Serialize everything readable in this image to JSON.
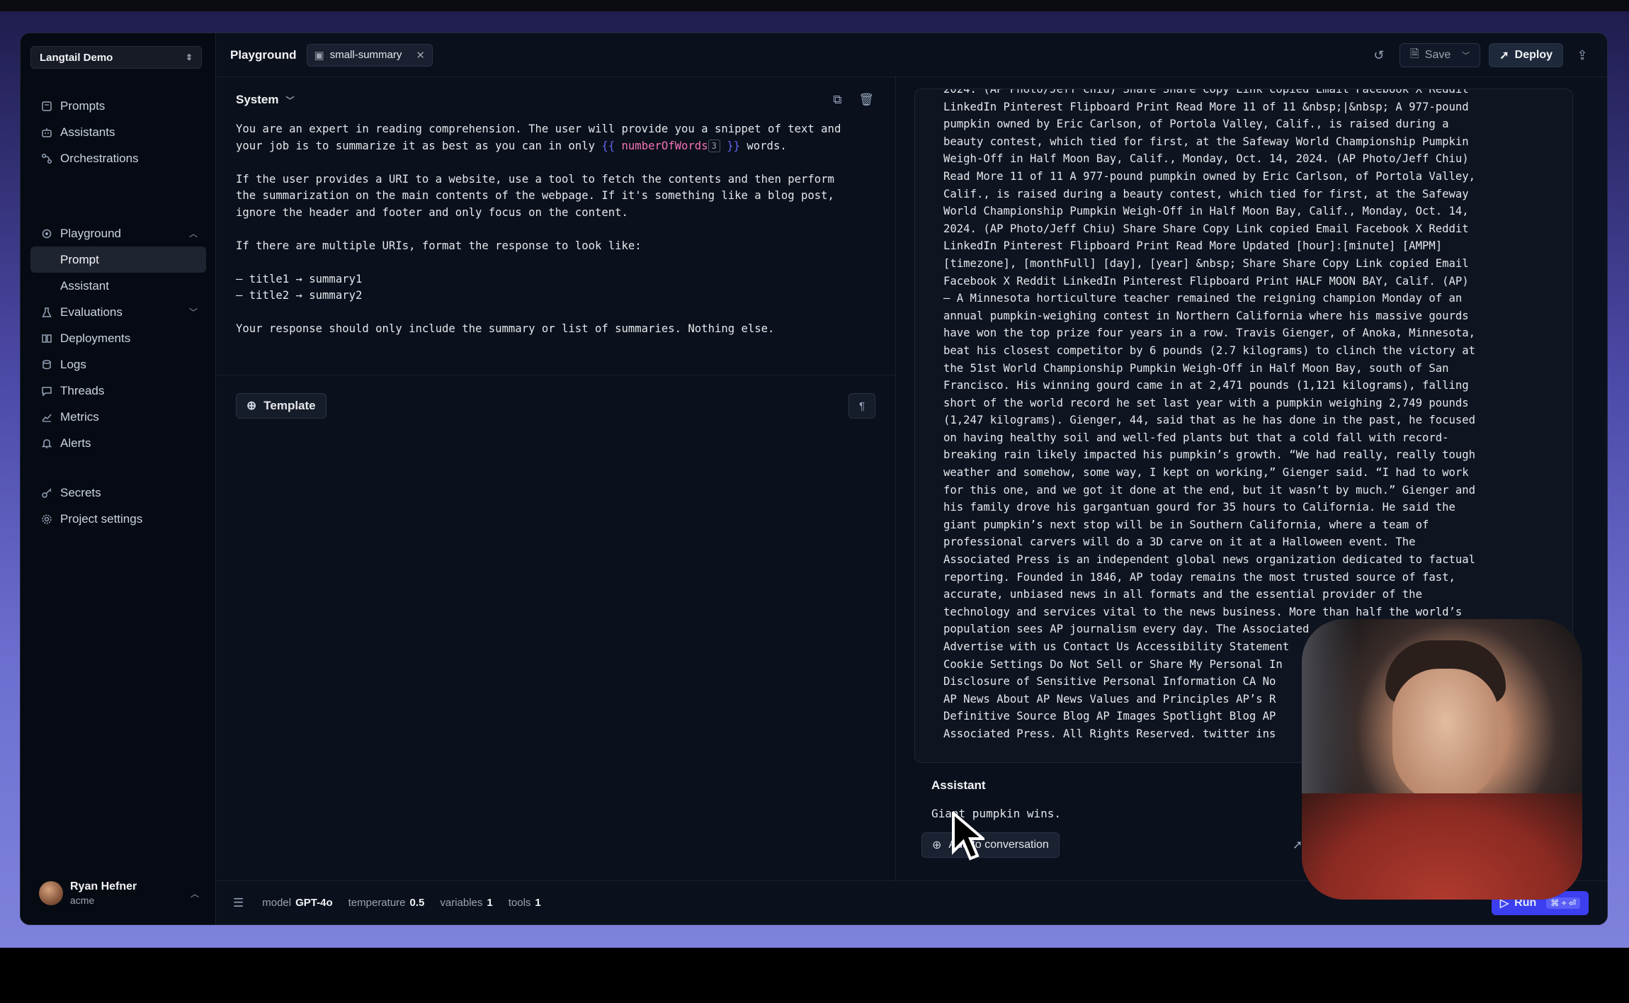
{
  "project": {
    "name": "Langtail Demo"
  },
  "sidebar": {
    "items": [
      {
        "label": "Prompts",
        "icon": "file-icon"
      },
      {
        "label": "Assistants",
        "icon": "robot-icon"
      },
      {
        "label": "Orchestrations",
        "icon": "flow-icon"
      },
      {
        "label": "Playground",
        "icon": "playground-icon"
      },
      {
        "label": "Prompt"
      },
      {
        "label": "Assistant"
      },
      {
        "label": "Evaluations",
        "icon": "flask-icon"
      },
      {
        "label": "Deployments",
        "icon": "deploy-icon"
      },
      {
        "label": "Logs",
        "icon": "database-icon"
      },
      {
        "label": "Threads",
        "icon": "chat-icon"
      },
      {
        "label": "Metrics",
        "icon": "chart-icon"
      },
      {
        "label": "Alerts",
        "icon": "bell-icon"
      },
      {
        "label": "Secrets",
        "icon": "key-icon"
      },
      {
        "label": "Project settings",
        "icon": "gear-icon"
      }
    ],
    "user": {
      "name": "Ryan Hefner",
      "org": "acme"
    }
  },
  "topbar": {
    "breadcrumb": "Playground",
    "tab": "small-summary",
    "save_label": "Save",
    "deploy_label": "Deploy"
  },
  "editor": {
    "system_label": "System",
    "prompt_line1": "You are an expert in reading comprehension. The user will provide you a snippet of text and",
    "prompt_line2_before": "your job is to summarize it as best as you can in only ",
    "var_open": "{{",
    "var_name": "numberOfWords",
    "var_value": "3",
    "var_close": "}}",
    "prompt_line2_after": " words.",
    "prompt_rest": "\nIf the user provides a URI to a website, use a tool to fetch the contents and then perform\nthe summarization on the main contents of the webpage. If it's something like a blog post,\nignore the header and footer and only focus on the content.\n\nIf there are multiple URIs, format the response to look like:\n\n— title1 → summary1\n— title2 → summary2\n\nYour response should only include the summary or list of summaries. Nothing else.",
    "template_label": "Template"
  },
  "conversation": {
    "user_message": "2024. (AP Photo/Jeff Chiu) Share Share Copy Link copied Email Facebook X Reddit\nLinkedIn Pinterest Flipboard Print Read More 11 of 11 &nbsp;|&nbsp; A 977-pound\npumpkin owned by Eric Carlson, of Portola Valley, Calif., is raised during a\nbeauty contest, which tied for first, at the Safeway World Championship Pumpkin\nWeigh-Off in Half Moon Bay, Calif., Monday, Oct. 14, 2024. (AP Photo/Jeff Chiu)\nRead More 11 of 11 A 977-pound pumpkin owned by Eric Carlson, of Portola Valley,\nCalif., is raised during a beauty contest, which tied for first, at the Safeway\nWorld Championship Pumpkin Weigh-Off in Half Moon Bay, Calif., Monday, Oct. 14,\n2024. (AP Photo/Jeff Chiu) Share Share Copy Link copied Email Facebook X Reddit\nLinkedIn Pinterest Flipboard Print Read More Updated [hour]:[minute] [AMPM]\n[timezone], [monthFull] [day], [year] &nbsp; Share Share Copy Link copied Email\nFacebook X Reddit LinkedIn Pinterest Flipboard Print HALF MOON BAY, Calif. (AP)\n— A Minnesota horticulture teacher remained the reigning champion Monday of an\nannual pumpkin-weighing contest in Northern California where his massive gourds\nhave won the top prize four years in a row. Travis Gienger, of Anoka, Minnesota,\nbeat his closest competitor by 6 pounds (2.7 kilograms) to clinch the victory at\nthe 51st World Championship Pumpkin Weigh-Off in Half Moon Bay, south of San\nFrancisco. His winning gourd came in at 2,471 pounds (1,121 kilograms), falling\nshort of the world record he set last year with a pumpkin weighing 2,749 pounds\n(1,247 kilograms). Gienger, 44, said that as he has done in the past, he focused\non having healthy soil and well-fed plants but that a cold fall with record-\nbreaking rain likely impacted his pumpkin’s growth. “We had really, really tough\nweather and somehow, some way, I kept on working,” Gienger said. “I had to work\nfor this one, and we got it done at the end, but it wasn’t by much.” Gienger and\nhis family drove his gargantuan gourd for 35 hours to California. He said the\ngiant pumpkin’s next stop will be in Southern California, where a team of\nprofessional carvers will do a 3D carve on it at a Halloween event. The\nAssociated Press is an independent global news organization dedicated to factual\nreporting. Founded in 1846, AP today remains the most trusted source of fast,\naccurate, unbiased news in all formats and the essential provider of the\ntechnology and services vital to the news business. More than half the world’s\npopulation sees AP journalism every day. The Associated\nAdvertise with us Contact Us Accessibility Statement\nCookie Settings Do Not Sell or Share My Personal In\nDisclosure of Sensitive Personal Information CA No\nAP News About AP News Values and Principles AP’s R\nDefinitive Source Blog AP Images Spotlight Blog AP\nAssociated Press. All Rights Reserved. twitter ins",
    "assistant_label": "Assistant",
    "assistant_reply": "Giant pumpkin wins.",
    "add_button": "Add to conversation"
  },
  "bottombar": {
    "model_label": "model",
    "model_value": "GPT-4o",
    "temp_label": "temperature",
    "temp_value": "0.5",
    "vars_label": "variables",
    "vars_value": "1",
    "tools_label": "tools",
    "tools_value": "1",
    "run_label": "Run",
    "run_shortcut": "⌘ + ⏎"
  }
}
